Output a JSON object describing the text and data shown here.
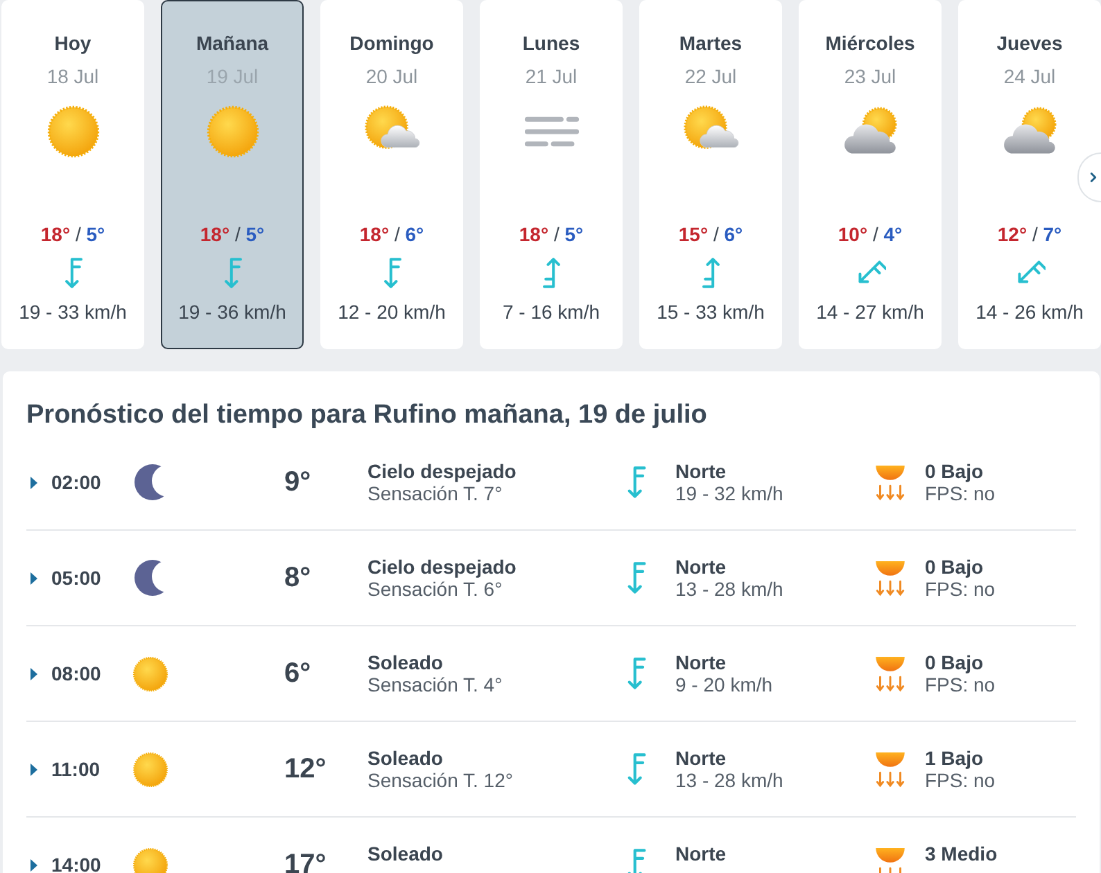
{
  "days": [
    {
      "day": "Hoy",
      "date": "18 Jul",
      "sky": {
        "kind": "sun"
      },
      "high": "18°",
      "separator": "/",
      "low": "5°",
      "wind_arrow": {
        "kind": "north"
      },
      "wind": "19 - 33 km/h",
      "selected": false
    },
    {
      "day": "Mañana",
      "date": "19 Jul",
      "sky": {
        "kind": "sun"
      },
      "high": "18°",
      "separator": "/",
      "low": "5°",
      "wind_arrow": {
        "kind": "north"
      },
      "wind": "19 - 36 km/h",
      "selected": true
    },
    {
      "day": "Domingo",
      "date": "20 Jul",
      "sky": {
        "kind": "sun_cloud"
      },
      "high": "18°",
      "separator": "/",
      "low": "6°",
      "wind_arrow": {
        "kind": "north"
      },
      "wind": "12 - 20 km/h",
      "selected": false
    },
    {
      "day": "Lunes",
      "date": "21 Jul",
      "sky": {
        "kind": "fog"
      },
      "high": "18°",
      "separator": "/",
      "low": "5°",
      "wind_arrow": {
        "kind": "south"
      },
      "wind": "7 - 16 km/h",
      "selected": false
    },
    {
      "day": "Martes",
      "date": "22 Jul",
      "sky": {
        "kind": "sun_cloud"
      },
      "high": "15°",
      "separator": "/",
      "low": "6°",
      "wind_arrow": {
        "kind": "south"
      },
      "wind": "15 - 33 km/h",
      "selected": false
    },
    {
      "day": "Miércoles",
      "date": "23 Jul",
      "sky": {
        "kind": "cloud_sun"
      },
      "high": "10°",
      "separator": "/",
      "low": "4°",
      "wind_arrow": {
        "kind": "northeast"
      },
      "wind": "14 - 27 km/h",
      "selected": false
    },
    {
      "day": "Jueves",
      "date": "24 Jul",
      "sky": {
        "kind": "cloud_sun"
      },
      "high": "12°",
      "separator": "/",
      "low": "7°",
      "wind_arrow": {
        "kind": "northeast"
      },
      "wind": "14 - 26 km/h",
      "selected": false
    }
  ],
  "forecast": {
    "title": "Pronóstico del tiempo para Rufino mañana, 19 de julio",
    "rows": [
      {
        "time": "02:00",
        "expanded": false,
        "sky": {
          "kind": "moon"
        },
        "temp": "9°",
        "condition": "Cielo despejado",
        "feels_like": "Sensación T. 7°",
        "wind_arrow": {
          "kind": "north"
        },
        "wind_name": "Norte",
        "wind": "19 - 32 km/h",
        "uv": "0 Bajo",
        "fps": "FPS: no"
      },
      {
        "time": "05:00",
        "expanded": false,
        "sky": {
          "kind": "moon"
        },
        "temp": "8°",
        "condition": "Cielo despejado",
        "feels_like": "Sensación T. 6°",
        "wind_arrow": {
          "kind": "north"
        },
        "wind_name": "Norte",
        "wind": "13 - 28 km/h",
        "uv": "0 Bajo",
        "fps": "FPS: no"
      },
      {
        "time": "08:00",
        "expanded": false,
        "sky": {
          "kind": "sun"
        },
        "temp": "6°",
        "condition": "Soleado",
        "feels_like": "Sensación T. 4°",
        "wind_arrow": {
          "kind": "north"
        },
        "wind_name": "Norte",
        "wind": "9 - 20 km/h",
        "uv": "0 Bajo",
        "fps": "FPS: no"
      },
      {
        "time": "11:00",
        "expanded": false,
        "sky": {
          "kind": "sun"
        },
        "temp": "12°",
        "condition": "Soleado",
        "feels_like": "Sensación T. 12°",
        "wind_arrow": {
          "kind": "north"
        },
        "wind_name": "Norte",
        "wind": "13 - 28 km/h",
        "uv": "1 Bajo",
        "fps": "FPS: no"
      },
      {
        "time": "14:00",
        "expanded": false,
        "sky": {
          "kind": "sun"
        },
        "temp": "17°",
        "condition": "Soleado",
        "wind_arrow": {
          "kind": "north"
        },
        "wind_name": "Norte",
        "uv": "3 Medio"
      }
    ]
  }
}
